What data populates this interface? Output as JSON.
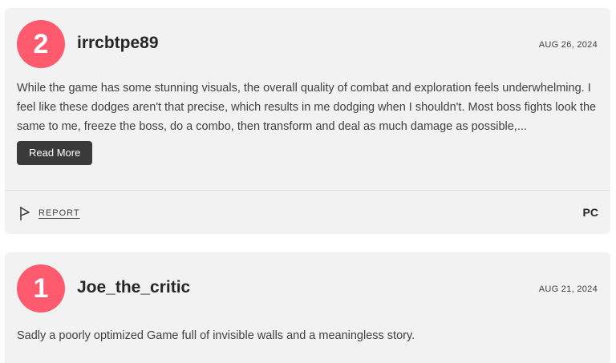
{
  "reviews": [
    {
      "score": "2",
      "score_color": "#ff5a6e",
      "username": "irrcbtpe89",
      "date": "AUG 26, 2024",
      "text": "While the game has some stunning visuals, the overall quality of combat and exploration feels underwhelming. I feel like these dodges aren't that precise, which results in me dodging when I shouldn't. Most boss fights look the same to me, freeze the boss, do a combo, then transform and deal as much damage as possible,...",
      "read_more_label": "Read More",
      "report_label": "REPORT",
      "platform": "PC"
    },
    {
      "score": "1",
      "score_color": "#ff5a6e",
      "username": "Joe_the_critic",
      "date": "AUG 21, 2024",
      "text": "Sadly a poorly optimized Game full of invisible walls and a meaningless story."
    }
  ],
  "icons": {
    "report": "flag-icon"
  }
}
